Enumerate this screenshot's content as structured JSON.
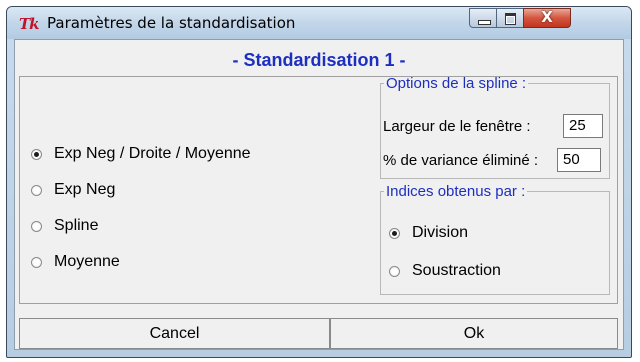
{
  "window": {
    "title": "Paramètres de la standardisation",
    "icon": "Tk",
    "icon_color": "#c0142a",
    "close_glyph": "X"
  },
  "heading": "- Standardisation 1 -",
  "method_options": [
    {
      "label": "Exp Neg / Droite / Moyenne",
      "checked": true
    },
    {
      "label": "Exp Neg",
      "checked": false
    },
    {
      "label": "Spline",
      "checked": false
    },
    {
      "label": "Moyenne",
      "checked": false
    }
  ],
  "spline_options": {
    "legend": "Options de la spline :",
    "window_width_label": "Largeur de le fenêtre :",
    "window_width_value": "25",
    "variance_label": "% de variance éliminé :",
    "variance_value": "50"
  },
  "indices": {
    "legend": "Indices obtenus par :",
    "options": [
      {
        "label": "Division",
        "checked": true
      },
      {
        "label": "Soustraction",
        "checked": false
      }
    ]
  },
  "buttons": {
    "cancel": "Cancel",
    "ok": "Ok"
  },
  "colors": {
    "accent_text": "#1d2fbf",
    "close_button": "#c2361f"
  }
}
